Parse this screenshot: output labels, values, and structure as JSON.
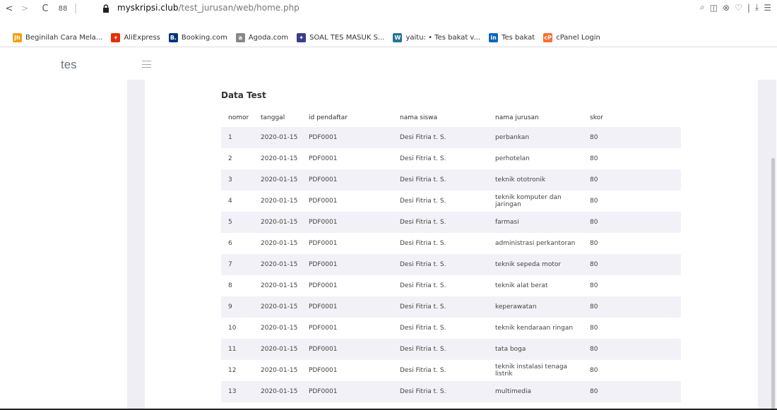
{
  "browser": {
    "url_domain": "myskripsi.club",
    "url_path": "/test_jurusan/web/home.php",
    "nav": {
      "back": "<",
      "forward": ">",
      "reload": "C",
      "apps": "88"
    },
    "right_icons": [
      "⌕",
      "◫",
      "⊗",
      "♡",
      "|",
      "⤓",
      "☰"
    ]
  },
  "bookmarks": [
    {
      "label": "Beginilah Cara Mela...",
      "icon": "jh-icon",
      "glyph": "Jh",
      "color": "#f59e0b"
    },
    {
      "label": "AliExpress",
      "icon": "aliexpress-icon",
      "glyph": "▾",
      "color": "#e62e04"
    },
    {
      "label": "Booking.com",
      "icon": "booking-icon",
      "glyph": "B.",
      "color": "#003580"
    },
    {
      "label": "Agoda.com",
      "icon": "agoda-icon",
      "glyph": "a",
      "color": "#888888"
    },
    {
      "label": "SOAL TES MASUK S...",
      "icon": "soal-tes-icon",
      "glyph": "✦",
      "color": "#3b3b8f"
    },
    {
      "label": "yaitu: • Tes bakat v...",
      "icon": "wordpress-icon",
      "glyph": "W",
      "color": "#21759b"
    },
    {
      "label": "Tes bakat",
      "icon": "linkedin-icon",
      "glyph": "in",
      "color": "#0a66c2"
    },
    {
      "label": "cPanel Login",
      "icon": "cpanel-icon",
      "glyph": "cP",
      "color": "#ff6c2c"
    }
  ],
  "app": {
    "brand": "tes"
  },
  "card": {
    "title": "Data Test"
  },
  "table": {
    "headers": [
      "nomor",
      "tanggal",
      "id pendaftar",
      "nama siswa",
      "nama jurusan",
      "skor"
    ],
    "rows": [
      [
        "1",
        "2020-01-15",
        "PDF0001",
        "Desi Fitria t. S.",
        "perbankan",
        "80"
      ],
      [
        "2",
        "2020-01-15",
        "PDF0001",
        "Desi Fitria t. S.",
        "perhotelan",
        "80"
      ],
      [
        "3",
        "2020-01-15",
        "PDF0001",
        "Desi Fitria t. S.",
        "teknik ototronik",
        "80"
      ],
      [
        "4",
        "2020-01-15",
        "PDF0001",
        "Desi Fitria t. S.",
        "teknik komputer dan jaringan",
        "80"
      ],
      [
        "5",
        "2020-01-15",
        "PDF0001",
        "Desi Fitria t. S.",
        "farmasi",
        "80"
      ],
      [
        "6",
        "2020-01-15",
        "PDF0001",
        "Desi Fitria t. S.",
        "administrasi perkantoran",
        "80"
      ],
      [
        "7",
        "2020-01-15",
        "PDF0001",
        "Desi Fitria t. S.",
        "teknik sepeda motor",
        "80"
      ],
      [
        "8",
        "2020-01-15",
        "PDF0001",
        "Desi Fitria t. S.",
        "teknik alat berat",
        "80"
      ],
      [
        "9",
        "2020-01-15",
        "PDF0001",
        "Desi Fitria t. S.",
        "keperawatan",
        "80"
      ],
      [
        "10",
        "2020-01-15",
        "PDF0001",
        "Desi Fitria t. S.",
        "teknik kendaraan ringan",
        "80"
      ],
      [
        "11",
        "2020-01-15",
        "PDF0001",
        "Desi Fitria t. S.",
        "tata boga",
        "80"
      ],
      [
        "12",
        "2020-01-15",
        "PDF0001",
        "Desi Fitria t. S.",
        "teknik instalasi tenaga listrik",
        "80"
      ],
      [
        "13",
        "2020-01-15",
        "PDF0001",
        "Desi Fitria t. S.",
        "multimedia",
        "80"
      ]
    ]
  }
}
